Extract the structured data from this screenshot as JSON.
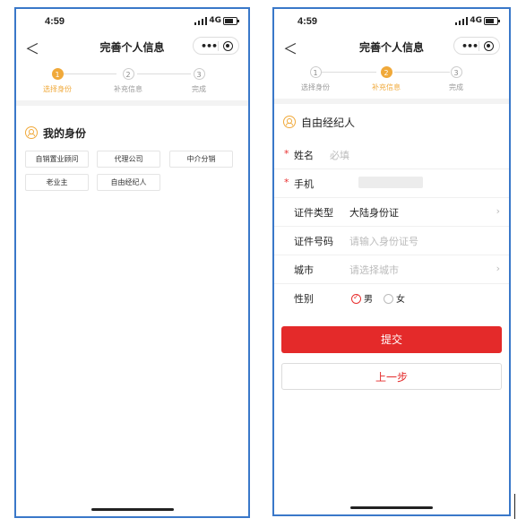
{
  "status_bar": {
    "time": "4:59",
    "network": "4G"
  },
  "nav": {
    "title": "完善个人信息",
    "back_glyph": "＜",
    "more_glyph": "•••"
  },
  "steps": [
    {
      "num": "1",
      "label": "选择身份"
    },
    {
      "num": "2",
      "label": "补充信息"
    },
    {
      "num": "3",
      "label": "完成"
    }
  ],
  "screen1": {
    "active_step": 1,
    "section_title": "我的身份",
    "identity_options": [
      "自销置业顾问",
      "代理公司",
      "中介分销",
      "老业主",
      "自由经纪人"
    ]
  },
  "screen2": {
    "active_step": 2,
    "section_title": "自由经纪人",
    "fields": {
      "name": {
        "label": "姓名",
        "placeholder": "必填",
        "required_mark": "*"
      },
      "phone": {
        "label": "手机",
        "required_mark": "*"
      },
      "id_type": {
        "label": "证件类型",
        "value": "大陆身份证"
      },
      "id_number": {
        "label": "证件号码",
        "placeholder": "请输入身份证号"
      },
      "city": {
        "label": "城市",
        "placeholder": "请选择城市"
      },
      "gender": {
        "label": "性别",
        "options": [
          "男",
          "女"
        ],
        "selected": "男"
      }
    },
    "submit_label": "提交",
    "prev_label": "上一步"
  },
  "colors": {
    "accent": "#f0a93a",
    "primary": "#e42a2a",
    "frame": "#3a78c9"
  }
}
